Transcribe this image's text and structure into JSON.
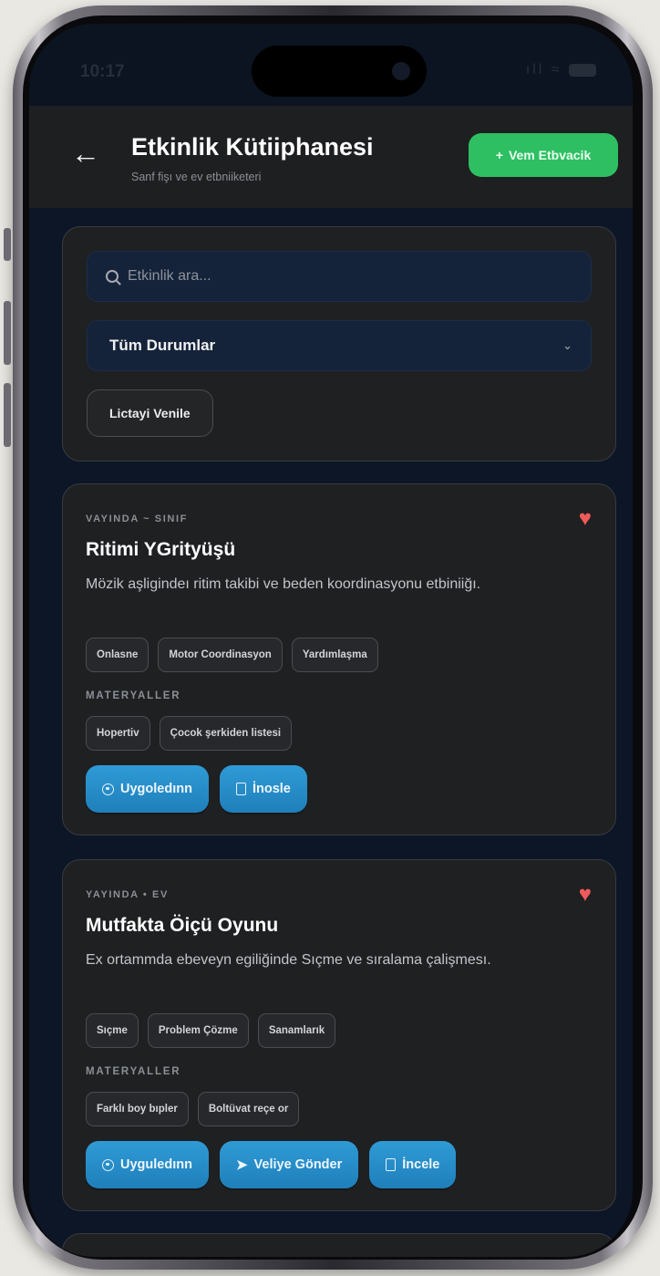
{
  "status": {
    "time": "10:17",
    "icons": "ıll ≈"
  },
  "header": {
    "back_icon": "arrow-left-icon",
    "title": "Etkinlik Kütiiphanesi",
    "subtitle": "Sanf fişı ve ev etbniiketeri",
    "new_button": {
      "icon": "+",
      "label": "Vem Etbvacik"
    }
  },
  "filters": {
    "search_placeholder": "Etkinlik ara...",
    "status_select": "Tüm Durumlar",
    "refresh_label": "Lictayi Venile"
  },
  "colors": {
    "accent_blue": "#2f9bd6",
    "accent_green": "#2ebf63",
    "heart": "#ef5b5b",
    "card_bg": "#1e2022"
  },
  "activities": [
    {
      "meta": "VAYINDA ~ SINIF",
      "title": "Ritimi YGrityüşü",
      "description": "Mözik aşligindeı ritim takibi ve beden koordinasyonu etbiniiğı.",
      "tags": [
        "Onlasne",
        "Motor Coordinasyon",
        "Yardımlaşma"
      ],
      "materials_label": "MATERYALLER",
      "materials": [
        "Hopertiv",
        "Çocok şerkiden listesi"
      ],
      "actions": [
        {
          "icon": "circle-dot-icon",
          "label": "Uygoledınn"
        },
        {
          "icon": "document-icon",
          "label": "İnosle"
        }
      ]
    },
    {
      "meta": "YAYINDA • EV",
      "title": "Mutfakta Öiçü Oyunu",
      "description": "Ex ortammda ebeveyn egiliğinde Sıçme ve sıralama çalişmesı.",
      "tags": [
        "Sıçme",
        "Problem Çözme",
        "Sanamlarık"
      ],
      "materials_label": "MATERYALLER",
      "materials": [
        "Farklı boy bıpler",
        "Boltüvat reçe or"
      ],
      "actions": [
        {
          "icon": "circle-dot-icon",
          "label": "Uyguledınn"
        },
        {
          "icon": "send-icon",
          "label": "Veliye Gönder"
        },
        {
          "icon": "document-icon",
          "label": "İncele"
        }
      ]
    }
  ]
}
